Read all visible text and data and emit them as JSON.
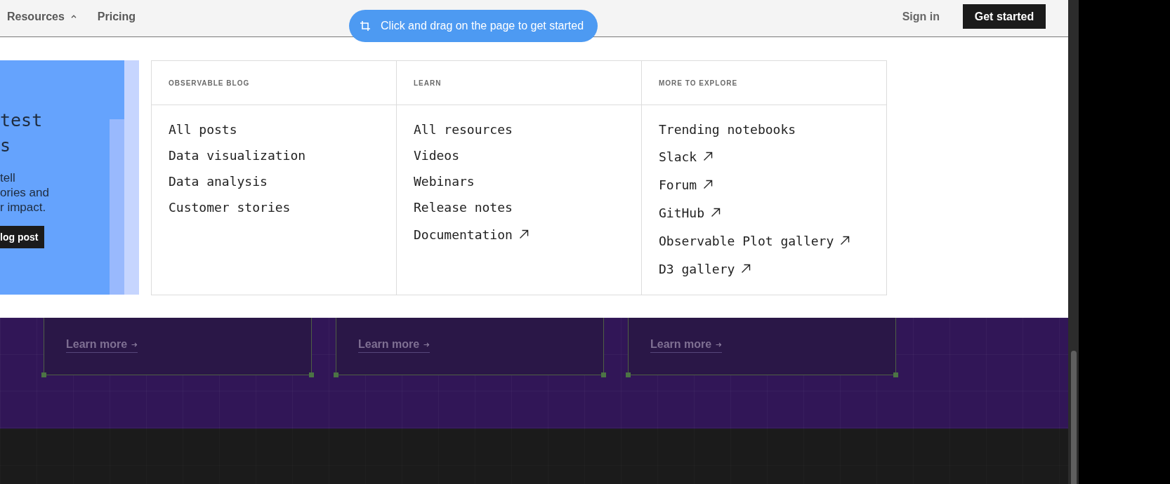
{
  "header": {
    "menu": {
      "label": "Resources",
      "expanded": true
    },
    "links": [
      {
        "label": "Pricing"
      }
    ],
    "sign_in": "Sign in",
    "cta": "Get started"
  },
  "capture_hint": {
    "text": "Click and drag on the page to get started"
  },
  "featured_post": {
    "heading_lines": [
      "test",
      "s"
    ],
    "text_lines": [
      "tell",
      "ories and",
      "r impact."
    ],
    "button": "log post"
  },
  "menu_columns": [
    {
      "heading": "OBSERVABLE BLOG",
      "items": [
        {
          "label": "All posts",
          "external": false
        },
        {
          "label": "Data visualization",
          "external": false
        },
        {
          "label": "Data analysis",
          "external": false
        },
        {
          "label": "Customer stories",
          "external": false
        }
      ]
    },
    {
      "heading": "LEARN",
      "items": [
        {
          "label": "All resources",
          "external": false
        },
        {
          "label": "Videos",
          "external": false
        },
        {
          "label": "Webinars",
          "external": false
        },
        {
          "label": "Release notes",
          "external": false
        },
        {
          "label": "Documentation",
          "external": true
        }
      ]
    },
    {
      "heading": "MORE TO EXPLORE",
      "items": [
        {
          "label": "Trending notebooks",
          "external": false
        },
        {
          "label": "Slack",
          "external": true
        },
        {
          "label": "Forum",
          "external": true
        },
        {
          "label": "GitHub",
          "external": true
        },
        {
          "label": "Observable Plot gallery",
          "external": true
        },
        {
          "label": "D3 gallery",
          "external": true
        }
      ]
    }
  ],
  "feature_cards": [
    {
      "link": "Learn more"
    },
    {
      "link": "Learn more"
    },
    {
      "link": "Learn more"
    }
  ]
}
